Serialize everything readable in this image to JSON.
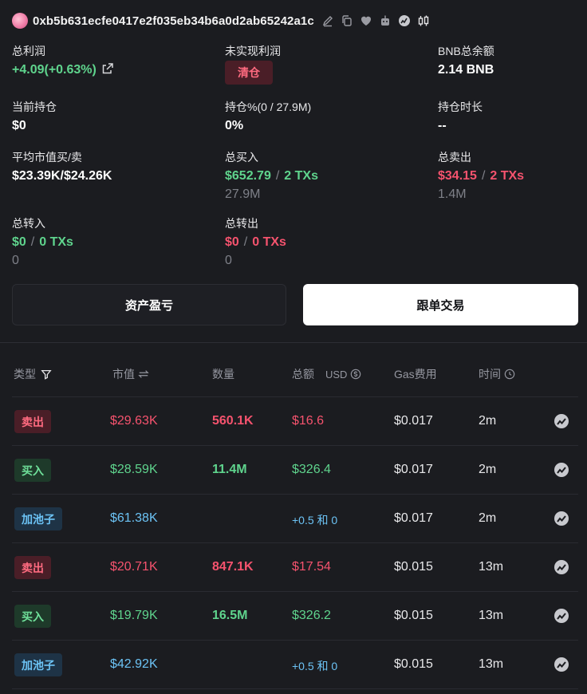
{
  "header": {
    "address": "0xb5b631ecfe0417e2f035eb34b6a0d2ab65242a1c"
  },
  "stats": {
    "total_profit": {
      "label": "总利润",
      "value": "+4.09(+0.63%)"
    },
    "unrealized_profit": {
      "label": "未实现利润",
      "button": "清仓"
    },
    "bnb_balance": {
      "label": "BNB总余额",
      "value": "2.14 BNB"
    },
    "current_holding": {
      "label": "当前持仓",
      "value": "$0"
    },
    "holding_pct": {
      "label": "持仓%(0 / 27.9M)",
      "value": "0%"
    },
    "holding_duration": {
      "label": "持仓时长",
      "value": "--"
    },
    "avg_mcap": {
      "label": "平均市值买/卖",
      "value": "$23.39K/$24.26K"
    },
    "total_buy": {
      "label": "总买入",
      "amount": "$652.79",
      "txs": "2 TXs",
      "tokens": "27.9M"
    },
    "total_sell": {
      "label": "总卖出",
      "amount": "$34.15",
      "txs": "2 TXs",
      "tokens": "1.4M"
    },
    "total_transfer_in": {
      "label": "总转入",
      "amount": "$0",
      "txs": "0 TXs",
      "tokens": "0"
    },
    "total_transfer_out": {
      "label": "总转出",
      "amount": "$0",
      "txs": "0 TXs",
      "tokens": "0"
    },
    "separator": "/"
  },
  "buttons": {
    "pnl": "资产盈亏",
    "copy_trade": "跟单交易"
  },
  "table": {
    "headers": {
      "type": "类型",
      "mcap": "市值",
      "amount": "数量",
      "total": "总额",
      "total_unit": "USD",
      "gas": "Gas费用",
      "time": "时间"
    },
    "rows": [
      {
        "type": "卖出",
        "kind": "sell",
        "mcap": "$29.63K",
        "amount": "560.1K",
        "total": "$16.6",
        "gas": "$0.017",
        "time": "2m"
      },
      {
        "type": "买入",
        "kind": "buy",
        "mcap": "$28.59K",
        "amount": "11.4M",
        "total": "$326.4",
        "gas": "$0.017",
        "time": "2m"
      },
      {
        "type": "加池子",
        "kind": "pool",
        "mcap": "$61.38K",
        "amount": "",
        "total": "+0.5 和 0",
        "gas": "$0.017",
        "time": "2m"
      },
      {
        "type": "卖出",
        "kind": "sell",
        "mcap": "$20.71K",
        "amount": "847.1K",
        "total": "$17.54",
        "gas": "$0.015",
        "time": "13m"
      },
      {
        "type": "买入",
        "kind": "buy",
        "mcap": "$19.79K",
        "amount": "16.5M",
        "total": "$326.2",
        "gas": "$0.015",
        "time": "13m"
      },
      {
        "type": "加池子",
        "kind": "pool",
        "mcap": "$42.92K",
        "amount": "",
        "total": "+0.5 和 0",
        "gas": "$0.015",
        "time": "13m"
      }
    ]
  },
  "colors": {
    "background": "#1b1c20",
    "green": "#5fd48d",
    "red": "#f6536e",
    "blue": "#6cc3f5"
  }
}
